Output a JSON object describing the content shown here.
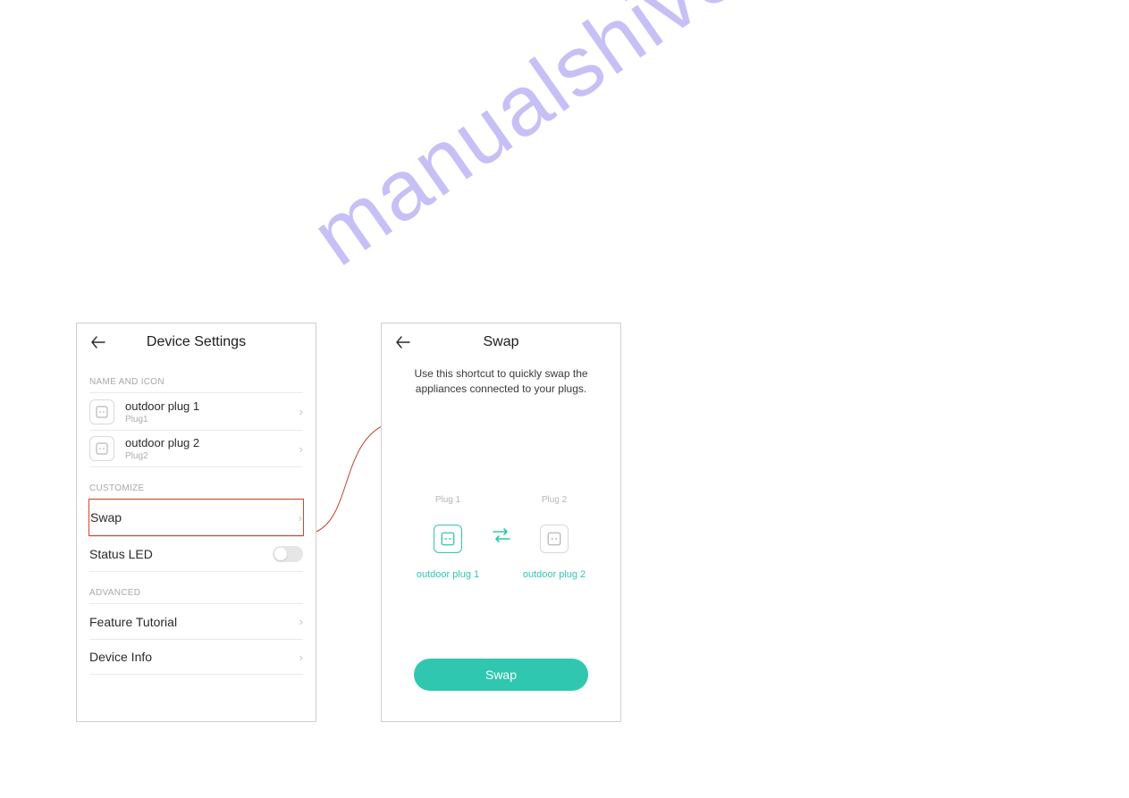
{
  "watermark": "manualshive.com",
  "left": {
    "title": "Device Settings",
    "sec_name_icon": "NAME AND ICON",
    "plug1_name": "outdoor plug 1",
    "plug1_sub": "Plug1",
    "plug2_name": "outdoor plug 2",
    "plug2_sub": "Plug2",
    "sec_customize": "CUSTOMIZE",
    "swap_label": "Swap",
    "status_led_label": "Status LED",
    "sec_advanced": "ADVANCED",
    "feature_tutorial": "Feature Tutorial",
    "device_info": "Device Info"
  },
  "right": {
    "title": "Swap",
    "description": "Use this shortcut to quickly swap the appliances connected to your plugs.",
    "plug1_label": "Plug 1",
    "plug2_label": "Plug 2",
    "plug1_name": "outdoor plug 1",
    "plug2_name": "outdoor plug 2",
    "swap_button": "Swap"
  }
}
